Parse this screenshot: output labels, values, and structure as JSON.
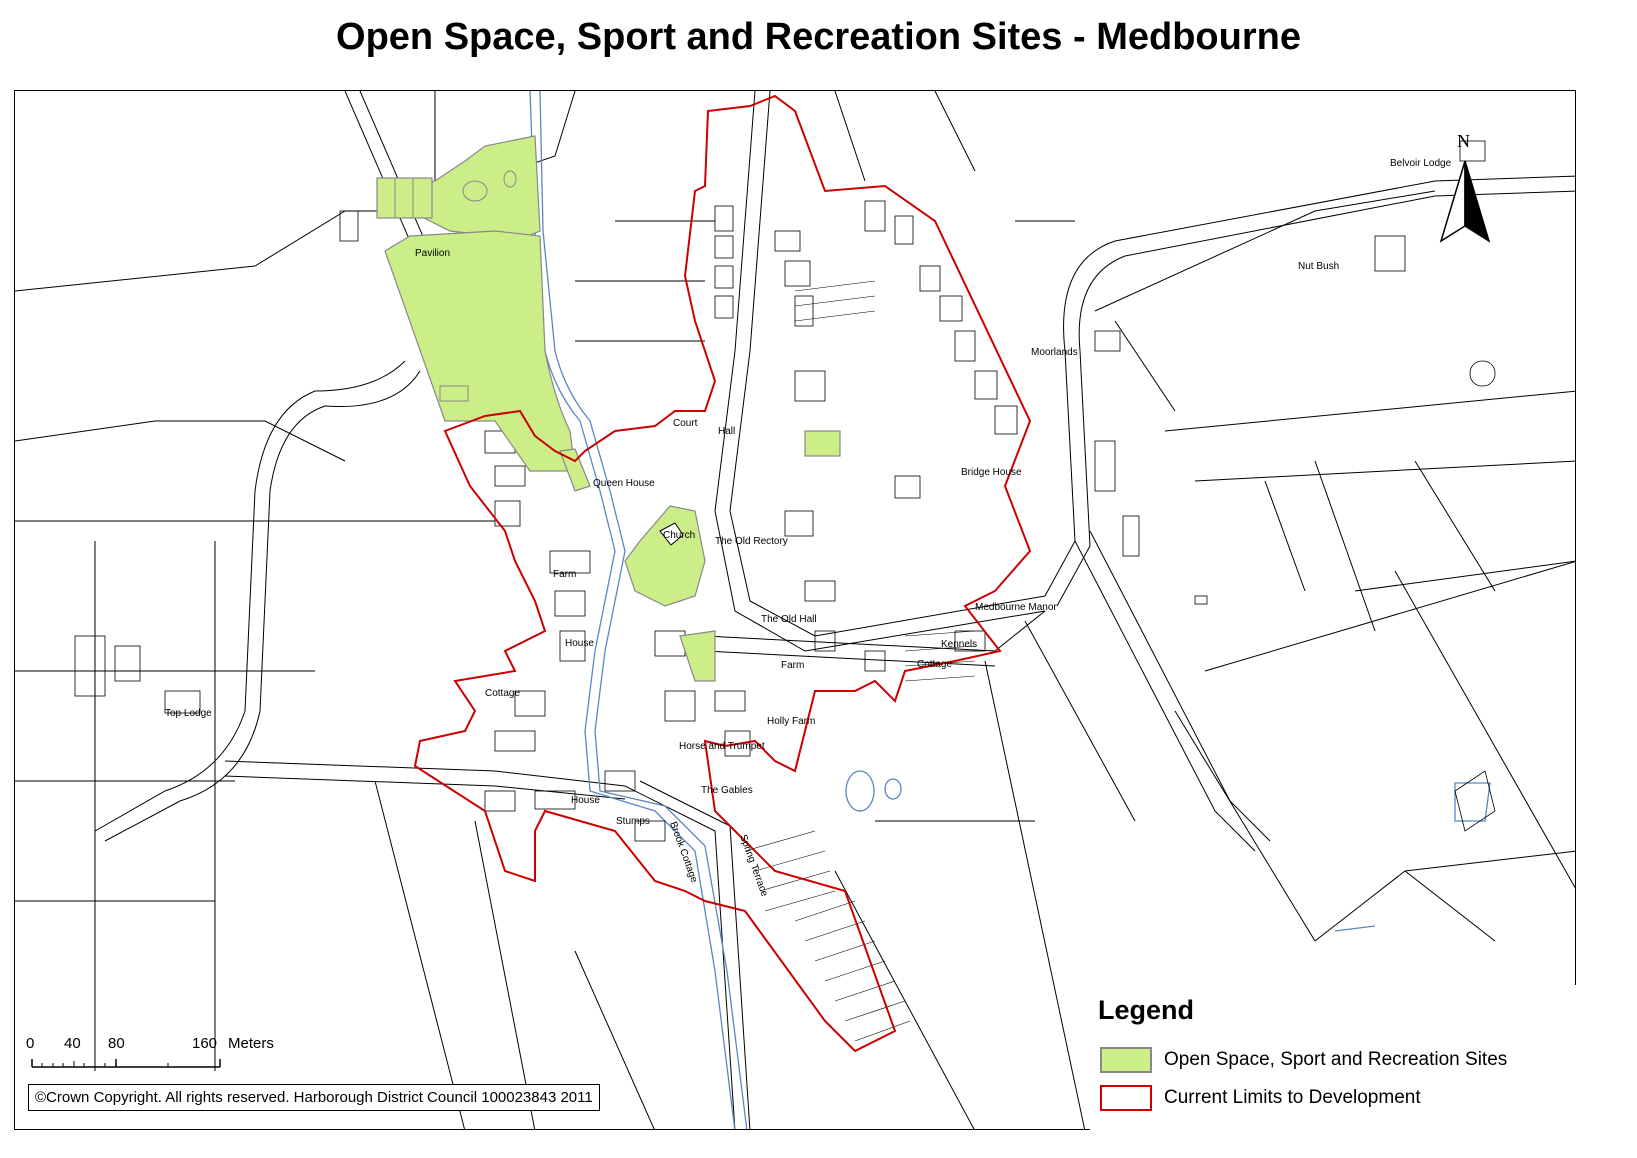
{
  "title": "Open Space, Sport and Recreation Sites - Medbourne",
  "colors": {
    "open_space_fill": "#ccee88",
    "limits_stroke": "#cc0000",
    "water": "#5b86c2",
    "line": "#000000"
  },
  "place_labels": [
    "Pavilion",
    "Queen House",
    "Church",
    "The Old Rectory",
    "Farm",
    "House",
    "The Old Hall",
    "Farm",
    "Holly Farm",
    "Horse and Trumpet",
    "The Gables",
    "House",
    "Stumps",
    "Brook Cottage",
    "Spring Terrace",
    "Top Lodge",
    "Moorlands",
    "Bridge House",
    "Medbourne Manor",
    "Kennels",
    "Cottage",
    "Nut Bush",
    "Belvoir Lodge",
    "Court",
    "Hall",
    "Cottage"
  ],
  "legend": {
    "title": "Legend",
    "items": [
      {
        "label": "Open Space, Sport and Recreation Sites",
        "fill": "#ccee88",
        "stroke": "#888888"
      },
      {
        "label": "Current Limits to Development",
        "fill": "#ffffff",
        "stroke": "#cc0000"
      }
    ]
  },
  "scalebar": {
    "ticks": [
      "0",
      "40",
      "80",
      "160"
    ],
    "unit": "Meters"
  },
  "north_arrow": {
    "letter": "N"
  },
  "copyright": "©Crown Copyright. All rights reserved.  Harborough District Council 100023843  2011"
}
